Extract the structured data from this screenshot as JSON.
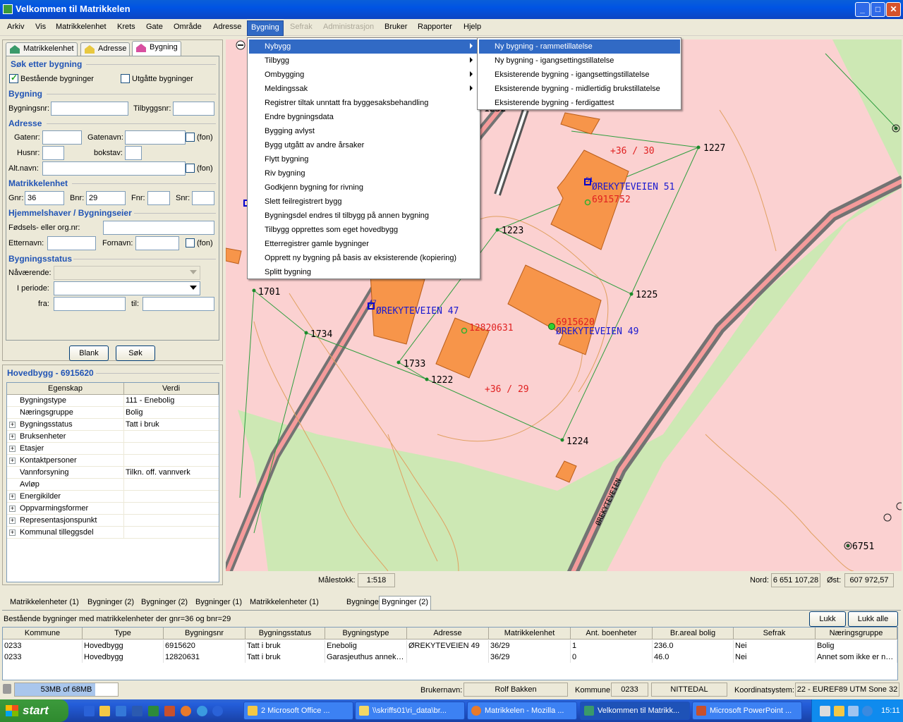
{
  "window": {
    "title": "Velkommen til Matrikkelen",
    "minimize": "_",
    "maximize": "□",
    "close": "✕"
  },
  "menubar": [
    "Arkiv",
    "Vis",
    "Matrikkelenhet",
    "Krets",
    "Gate",
    "Område",
    "Adresse",
    "Bygning",
    "Sefrak",
    "Administrasjon",
    "Bruker",
    "Rapporter",
    "Hjelp"
  ],
  "search": {
    "tabs": [
      "Matrikkelenhet",
      "Adresse",
      "Bygning"
    ],
    "heading": "Søk etter bygning",
    "existing_label": "Bestående bygninger",
    "existing_checked": true,
    "expired_label": "Utgåtte bygninger",
    "expired_checked": false,
    "bygning_section": "Bygning",
    "bygningsnr_label": "Bygningsnr:",
    "bygningsnr_value": "",
    "tilbyggsnr_label": "Tilbyggsnr:",
    "tilbyggsnr_value": "",
    "adresse_section": "Adresse",
    "gatenr_label": "Gatenr:",
    "gatenr_value": "",
    "gatenavn_label": "Gatenavn:",
    "gatenavn_value": "",
    "fon_label": "(fon)",
    "husnr_label": "Husnr:",
    "husnr_value": "",
    "bokstav_label": "bokstav:",
    "bokstav_value": "",
    "altnavn_label": "Alt.navn:",
    "altnavn_value": "",
    "matrikkelenhet_section": "Matrikkelenhet",
    "gnr_label": "Gnr:",
    "gnr_value": "36",
    "bnr_label": "Bnr:",
    "bnr_value": "29",
    "fnr_label": "Fnr:",
    "fnr_value": "",
    "snr_label": "Snr:",
    "snr_value": "",
    "owner_section": "Hjemmelshaver / Bygningseier",
    "orgnr_label": "Fødsels- eller org.nr:",
    "orgnr_value": "",
    "etternavn_label": "Etternavn:",
    "etternavn_value": "",
    "fornavn_label": "Fornavn:",
    "fornavn_value": "",
    "status_section": "Bygningsstatus",
    "navaerende_label": "Nåværende:",
    "navaerende_value": "",
    "iperiode_label": "I periode:",
    "iperiode_value": "",
    "fra_label": "fra:",
    "fra_value": "",
    "til_label": "til:",
    "til_value": "",
    "blank_button": "Blank",
    "sok_button": "Søk"
  },
  "properties": {
    "title": "Hovedbygg - 6915620",
    "col_property": "Egenskap",
    "col_value": "Verdi",
    "rows": [
      {
        "name": "Bygningstype",
        "value": "111 - Enebolig",
        "expandable": false
      },
      {
        "name": "Næringsgruppe",
        "value": "Bolig",
        "expandable": false
      },
      {
        "name": "Bygningsstatus",
        "value": "Tatt i bruk",
        "expandable": true
      },
      {
        "name": "Bruksenheter",
        "value": "",
        "expandable": true
      },
      {
        "name": "Etasjer",
        "value": "",
        "expandable": true
      },
      {
        "name": "Kontaktpersoner",
        "value": "",
        "expandable": true
      },
      {
        "name": "Vannforsyning",
        "value": "Tilkn. off. vannverk",
        "expandable": false
      },
      {
        "name": "Avløp",
        "value": "",
        "expandable": false
      },
      {
        "name": "Energikilder",
        "value": "",
        "expandable": true
      },
      {
        "name": "Oppvarmingsformer",
        "value": "",
        "expandable": true
      },
      {
        "name": "Representasjonspunkt",
        "value": "",
        "expandable": true
      },
      {
        "name": "Kommunal tilleggsdel",
        "value": "",
        "expandable": true
      }
    ]
  },
  "bygning_menu": {
    "items": [
      {
        "label": "Nybygg",
        "submenu": true,
        "highlighted": true
      },
      {
        "label": "Tilbygg",
        "submenu": true
      },
      {
        "label": "Ombygging",
        "submenu": true
      },
      {
        "label": "Meldingssak",
        "submenu": true
      },
      {
        "label": "Registrer tiltak unntatt fra byggesaksbehandling"
      },
      {
        "label": "Endre bygningsdata"
      },
      {
        "label": "Bygging avlyst"
      },
      {
        "label": "Bygg utgått av andre årsaker"
      },
      {
        "label": "Flytt bygning"
      },
      {
        "label": "Riv bygning"
      },
      {
        "label": "Godkjenn bygning for rivning"
      },
      {
        "label": "Slett feilregistrert bygg"
      },
      {
        "label": "Bygningsdel endres til tilbygg på annen bygning"
      },
      {
        "label": "Tilbygg opprettes som eget hovedbygg"
      },
      {
        "label": "Etterregistrer gamle bygninger"
      },
      {
        "label": "Opprett ny bygning på basis av eksisterende (kopiering)"
      },
      {
        "label": "Splitt bygning"
      }
    ]
  },
  "nybygg_submenu": {
    "items": [
      {
        "label": "Ny bygning - rammetillatelse",
        "highlighted": true
      },
      {
        "label": "Ny bygning - igangsettingstillatelse"
      },
      {
        "label": "Eksisterende bygning - igangsettingstillatelse"
      },
      {
        "label": "Eksisterende bygning - midlertidig brukstillatelse"
      },
      {
        "label": "Eksisterende bygning - ferdigattest"
      }
    ]
  },
  "map": {
    "labels": {
      "p1227": "1227",
      "p1223": "1223",
      "p1225": "1225",
      "p1701": "1701",
      "p1734": "1734",
      "p1733": "1733",
      "p1222": "1222",
      "p1224": "1224",
      "p6751": "6751",
      "parcel_3630": "+36 / 30",
      "parcel_3629": "+36 / 29",
      "addr51": "ØREKYTEVEIEN 51",
      "addr47": "ØREKYTEVEIEN 47",
      "addr49": "ØREKYTEVEIEN 49",
      "b6915752": "6915752",
      "b12820631": "12820631",
      "b6915620": "6915620",
      "n51": "51",
      "n47": "47",
      "road": "ØREKYTEVEIEN",
      "partial": "1232"
    },
    "scale_label": "Målestokk:",
    "scale_value": "1:518",
    "north_label": "Nord:",
    "north_value": "6 651 107,28",
    "east_label": "Øst:",
    "east_value": "607 972,57"
  },
  "results": {
    "tabs": [
      "Matrikkelenheter (1)",
      "Bygninger (2)",
      "Bygninger (2)",
      "Bygninger (1)",
      "Matrikkelenheter (1)",
      "Bygninger (1)",
      "Bygninger (2)"
    ],
    "info": "Bestående bygninger med  matrikkelenheter der gnr=36 og  bnr=29",
    "close_button": "Lukk",
    "close_all_button": "Lukk alle",
    "columns": [
      "Kommune",
      "Type",
      "Bygningsnr",
      "Bygningsstatus",
      "Bygningstype",
      "Adresse",
      "Matrikkelenhet",
      "Ant. boenheter",
      "Br.areal bolig",
      "Sefrak",
      "Næringsgruppe"
    ],
    "rows": [
      [
        "0233",
        "Hovedbygg",
        "6915620",
        "Tatt i bruk",
        "Enebolig",
        "ØREKYTEVEIEN 49",
        "36/29",
        "1",
        "236.0",
        "Nei",
        "Bolig"
      ],
      [
        "0233",
        "Hovedbygg",
        "12820631",
        "Tatt i bruk",
        "Garasjeuthus annek…",
        "",
        "36/29",
        "0",
        "46.0",
        "Nei",
        "Annet som ikke er n…"
      ]
    ]
  },
  "statusbar": {
    "memory": "53MB of 68MB",
    "memory_fraction": 0.78,
    "user_label": "Brukernavn:",
    "user_value": "Rolf Bakken",
    "kommune_label": "Kommune:",
    "kommune_value": "0233",
    "kommune_name": "NITTEDAL",
    "coord_label": "Koordinatsystem:",
    "coord_value": "22 - EUREF89 UTM Sone 32"
  },
  "taskbar": {
    "start": "start",
    "buttons": [
      "2 Microsoft Office ...",
      "\\\\skriffs01\\ri_data\\br...",
      "Matrikkelen - Mozilla ...",
      "Velkommen til Matrikk...",
      "Microsoft PowerPoint ..."
    ],
    "clock": "15:11"
  },
  "colors": {
    "accent": "#316ac5",
    "building": "#f7954a",
    "parcel": "#fbd1d1",
    "field": "#cde8b4",
    "road": "#737373",
    "section_heading": "#2154b5"
  }
}
